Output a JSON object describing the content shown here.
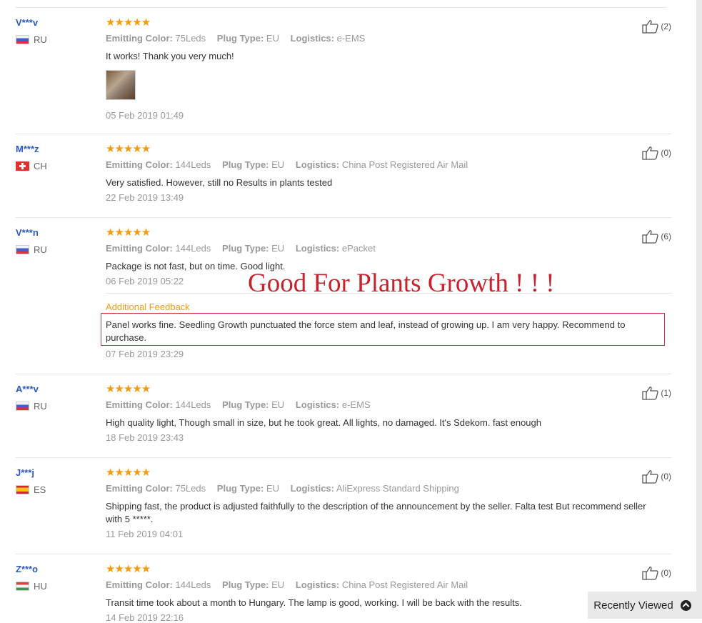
{
  "labels": {
    "emitting_color": "Emitting Color:",
    "plug_type": "Plug Type:",
    "logistics": "Logistics:"
  },
  "reviews": [
    {
      "user": "V***v",
      "country": "RU",
      "stars": "★★★★★",
      "emitting_color": "75Leds",
      "plug_type": "EU",
      "logistics": "e-EMS",
      "text": "It works! Thank you very much!",
      "has_photo": true,
      "date": "05 Feb 2019 01:49",
      "useful": "(2)"
    },
    {
      "user": "M***z",
      "country": "CH",
      "stars": "★★★★★",
      "emitting_color": "144Leds",
      "plug_type": "EU",
      "logistics": "China Post Registered Air Mail",
      "text": "Very satisfied. However, still no Results in plants tested",
      "date": "22 Feb 2019 13:49",
      "useful": "(0)"
    },
    {
      "user": "V***n",
      "country": "RU",
      "stars": "★★★★★",
      "emitting_color": "144Leds",
      "plug_type": "EU",
      "logistics": "ePacket",
      "text": "Package is not fast, but on time. Good light.",
      "date": "06 Feb 2019 05:22",
      "useful": "(6)",
      "additional_feedback": {
        "title": "Additional Feedback",
        "text": "Panel works fine. Seedling Growth punctuated the force stem and leaf, instead of growing up. I am very happy. Recommend to purchase.",
        "date": "07 Feb 2019 23:29"
      }
    },
    {
      "user": "A***v",
      "country": "RU",
      "stars": "★★★★★",
      "emitting_color": "144Leds",
      "plug_type": "EU",
      "logistics": "e-EMS",
      "text": "High quality light, Though small in size, but he took great. All lights, no damaged. It's Sdekom. fast enough",
      "date": "18 Feb 2019 23:43",
      "useful": "(1)"
    },
    {
      "user": "J***j",
      "country": "ES",
      "stars": "★★★★★",
      "emitting_color": "75Leds",
      "plug_type": "EU",
      "logistics": "AliExpress Standard Shipping",
      "text": "Shipping fast, the product is adjusted faithfully to the description of the announcement by the seller. Falta test But recommend seller with 5 *****.",
      "date": "11 Feb 2019 04:01",
      "useful": "(0)"
    },
    {
      "user": "Z***o",
      "country": "HU",
      "stars": "★★★★★",
      "emitting_color": "144Leds",
      "plug_type": "EU",
      "logistics": "China Post Registered Air Mail",
      "text": "Transit time took about a month to Hungary. The lamp is good, working. I will be back with the results.",
      "date": "14 Feb 2019 22:16",
      "useful": "(0)"
    }
  ],
  "overlay_text": "Good For Plants Growth ! ! !",
  "recently_viewed": "Recently Viewed",
  "colors": {
    "username": "#2b59c3",
    "stars": "#f79a0c",
    "additional_feedback": "#f39c12",
    "overlay": "#c8222d"
  }
}
